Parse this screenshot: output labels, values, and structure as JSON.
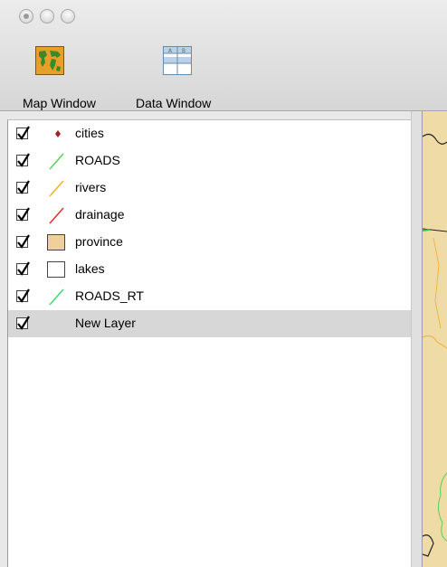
{
  "toolbar": {
    "map_window_label": "Map Window",
    "data_window_label": "Data Window"
  },
  "layers": [
    {
      "name": "cities",
      "checked": true,
      "symbol": "point-icon",
      "color": "#a02020"
    },
    {
      "name": "ROADS",
      "checked": true,
      "symbol": "line-icon",
      "color": "#58d058"
    },
    {
      "name": "rivers",
      "checked": true,
      "symbol": "line-icon",
      "color": "#f0b030"
    },
    {
      "name": "drainage",
      "checked": true,
      "symbol": "line-icon",
      "color": "#e03030"
    },
    {
      "name": "province",
      "checked": true,
      "symbol": "fill-icon",
      "color": "#efd09a"
    },
    {
      "name": "lakes",
      "checked": true,
      "symbol": "fill-icon",
      "color": "#ffffff"
    },
    {
      "name": "ROADS_RT",
      "checked": true,
      "symbol": "line-icon",
      "color": "#40d870"
    },
    {
      "name": "New Layer",
      "checked": true,
      "symbol": "none",
      "color": "",
      "selected": true
    }
  ],
  "colors": {
    "map_background": "#efdba6",
    "selection": "#d7d7d7"
  }
}
